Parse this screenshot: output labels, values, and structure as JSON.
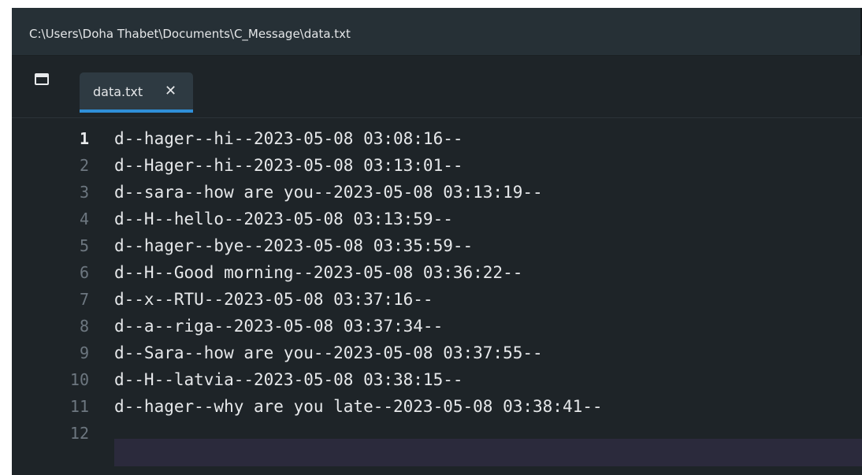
{
  "window": {
    "title": "C:\\Users\\Doha Thabet\\Documents\\C_Message\\data.txt"
  },
  "tabs": [
    {
      "label": "data.txt",
      "close": "✕",
      "active": true
    }
  ],
  "editor": {
    "current_line": 1,
    "lines": [
      {
        "number": "1",
        "text": "d--hager--hi--2023-05-08 03:08:16--"
      },
      {
        "number": "2",
        "text": "d--Hager--hi--2023-05-08 03:13:01--"
      },
      {
        "number": "3",
        "text": "d--sara--how are you--2023-05-08 03:13:19--"
      },
      {
        "number": "4",
        "text": "d--H--hello--2023-05-08 03:13:59--"
      },
      {
        "number": "5",
        "text": "d--hager--bye--2023-05-08 03:35:59--"
      },
      {
        "number": "6",
        "text": "d--H--Good morning--2023-05-08 03:36:22--"
      },
      {
        "number": "7",
        "text": "d--x--RTU--2023-05-08 03:37:16--"
      },
      {
        "number": "8",
        "text": "d--a--riga--2023-05-08 03:37:34--"
      },
      {
        "number": "9",
        "text": "d--Sara--how are you--2023-05-08 03:37:55--"
      },
      {
        "number": "10",
        "text": "d--H--latvia--2023-05-08 03:38:15--"
      },
      {
        "number": "11",
        "text": "d--hager--why are you late--2023-05-08 03:38:41--"
      },
      {
        "number": "12",
        "text": ""
      }
    ]
  },
  "colors": {
    "background": "#1e2428",
    "accent": "#2f8fd8",
    "text": "#e6e8ea",
    "line_number": "#6d7780"
  }
}
